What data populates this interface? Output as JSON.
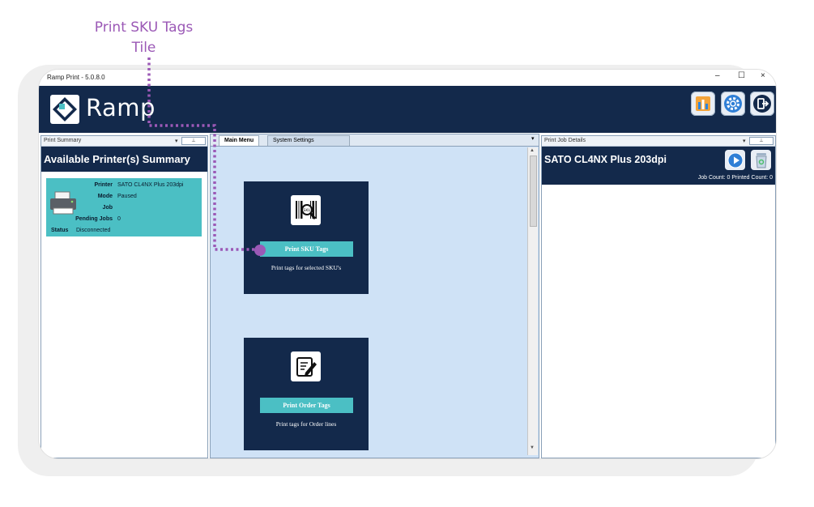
{
  "annotation": {
    "line1": "Print SKU Tags",
    "line2": "Tile",
    "color": "#9b59b6"
  },
  "window": {
    "title": "Ramp Print - 5.0.8.0",
    "controls": {
      "minimize": "–",
      "maximize": "☐",
      "close": "×"
    }
  },
  "header": {
    "logo_text": "Ramp",
    "background": "#13294b",
    "buttons": [
      "reports-icon",
      "settings-gear-icon",
      "logout-icon"
    ]
  },
  "left_panel": {
    "header_label": "Print Summary",
    "title": "Available Printer(s) Summary",
    "printer": {
      "labels": {
        "printer": "Printer",
        "mode": "Mode",
        "job": "Job",
        "pending_jobs": "Pending Jobs",
        "status": "Status"
      },
      "values": {
        "printer": "SATO CL4NX Plus 203dpi",
        "mode": "Paused",
        "job": "",
        "pending_jobs": "0",
        "status": "Disconnected"
      }
    }
  },
  "center_panel": {
    "tabs": [
      {
        "label": "Main Menu",
        "active": true
      },
      {
        "label": "System Settings",
        "active": false
      }
    ],
    "tiles": [
      {
        "icon": "sku-barcode-icon",
        "button_label": "Print SKU Tags",
        "description": "Print tags for selected SKU's"
      },
      {
        "icon": "order-edit-icon",
        "button_label": "Print Order Tags",
        "description": "Print tags for Order lines"
      }
    ]
  },
  "right_panel": {
    "header_label": "Print Job Details",
    "printer_name": "SATO CL4NX Plus 203dpi",
    "job_count_label": "Job Count:",
    "job_count": "0",
    "printed_count_label": "Printed Count:",
    "printed_count": "0",
    "buttons": [
      "play-icon",
      "recycle-bin-icon"
    ]
  },
  "colors": {
    "navy": "#13294b",
    "teal": "#4bbfc4",
    "center_bg": "#cfe2f6"
  }
}
